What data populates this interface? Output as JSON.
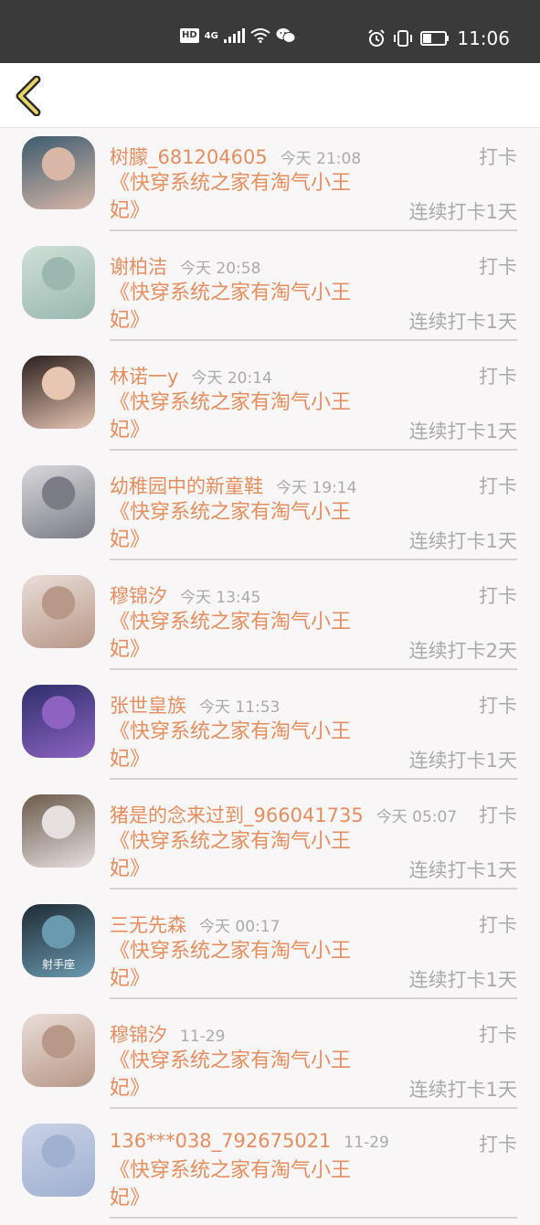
{
  "status_bar": {
    "hd": "HD",
    "network": "4G",
    "time": "11:06",
    "icons": [
      "hd-icon",
      "signal-icon",
      "wifi-icon",
      "wechat-icon",
      "alarm-icon",
      "vibrate-icon",
      "battery-icon"
    ]
  },
  "nav": {
    "back_icon": "chevron-left-icon"
  },
  "items": [
    {
      "name": "树朦_681204605",
      "time": "今天 21:08",
      "action": "打卡",
      "book": "《快穿系统之家有淘气小王妃》",
      "streak": "连续打卡1天",
      "avatar_colors": [
        "#3b5a6e",
        "#d9b8a8"
      ]
    },
    {
      "name": "谢柏洁",
      "time": "今天 20:58",
      "action": "打卡",
      "book": "《快穿系统之家有淘气小王妃》",
      "streak": "连续打卡1天",
      "avatar_colors": [
        "#cfe0d8",
        "#9ab8b0"
      ]
    },
    {
      "name": "林诺一y",
      "time": "今天 20:14",
      "action": "打卡",
      "book": "《快穿系统之家有淘气小王妃》",
      "streak": "连续打卡1天",
      "avatar_colors": [
        "#2a1f1c",
        "#e7c6b4"
      ]
    },
    {
      "name": "幼稚园中的新童鞋",
      "time": "今天 19:14",
      "action": "打卡",
      "book": "《快穿系统之家有淘气小王妃》",
      "streak": "连续打卡1天",
      "avatar_colors": [
        "#d8d8dc",
        "#7c7c86"
      ]
    },
    {
      "name": "穆锦汐",
      "time": "今天 13:45",
      "action": "打卡",
      "book": "《快穿系统之家有淘气小王妃》",
      "streak": "连续打卡2天",
      "avatar_colors": [
        "#e9ddd8",
        "#b89888"
      ]
    },
    {
      "name": "张世皇族",
      "time": "今天 11:53",
      "action": "打卡",
      "book": "《快穿系统之家有淘气小王妃》",
      "streak": "连续打卡1天",
      "avatar_colors": [
        "#2d2f6a",
        "#8d63c2"
      ]
    },
    {
      "name": "猪是的念来过到_966041735",
      "time": "今天 05:07",
      "action": "打卡",
      "book": "《快穿系统之家有淘气小王妃》",
      "streak": "连续打卡1天",
      "avatar_colors": [
        "#6b5a4a",
        "#e6e0e0"
      ]
    },
    {
      "name": "三无先森",
      "time": "今天 00:17",
      "action": "打卡",
      "book": "《快穿系统之家有淘气小王妃》",
      "streak": "连续打卡1天",
      "avatar_colors": [
        "#1e2a34",
        "#6a9ab0"
      ],
      "avatar_label": "射手座"
    },
    {
      "name": "穆锦汐",
      "time": "11-29",
      "action": "打卡",
      "book": "《快穿系统之家有淘气小王妃》",
      "streak": "连续打卡1天",
      "avatar_colors": [
        "#e9ddd8",
        "#b89888"
      ]
    },
    {
      "name": "136***038_792675021",
      "time": "11-29",
      "action": "打卡",
      "book": "《快穿系统之家有淘气小王妃》",
      "streak": "",
      "avatar_colors": [
        "#c9d2e6",
        "#9fb0d0"
      ]
    }
  ]
}
